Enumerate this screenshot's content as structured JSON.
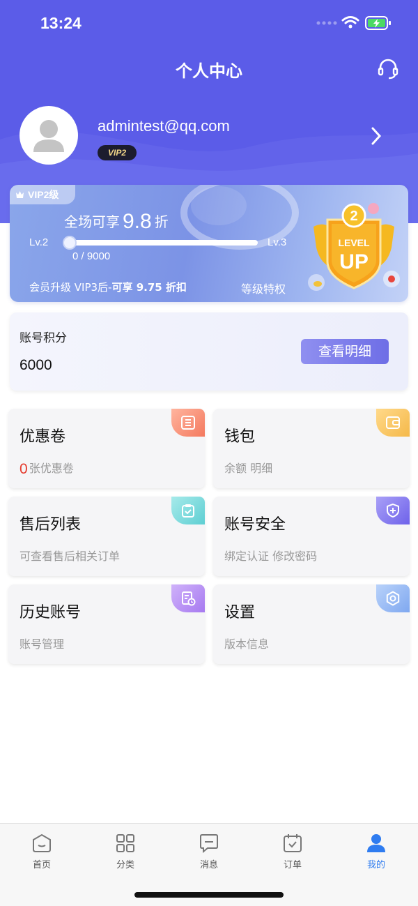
{
  "status_bar": {
    "time": "13:24"
  },
  "navbar": {
    "title": "个人中心"
  },
  "profile": {
    "email": "admintest@qq.com",
    "vip_badge": "VIP2"
  },
  "vip_card": {
    "tag": "VIP2级",
    "discount_prefix": "全场可享",
    "discount_value": "9.8",
    "discount_suffix": "折",
    "level_current": "Lv.2",
    "level_next": "Lv.3",
    "points_progress": "0 / 9000",
    "progress_fraction": 0,
    "upgrade_prefix": "会员升级 VIP3后-",
    "upgrade_bold": "可享 9.75 折扣",
    "privileges_link": "等级特权",
    "badge_text": [
      "LEVEL",
      "UP"
    ]
  },
  "points_card": {
    "label": "账号积分",
    "value": "6000",
    "detail_button": "查看明细"
  },
  "tiles": [
    {
      "title": "优惠卷",
      "count": "0",
      "subtitle": "张优惠卷",
      "icon": "coupon-icon",
      "color": "#f47a5f"
    },
    {
      "title": "钱包",
      "subtitle": "余额 明细",
      "icon": "wallet-icon",
      "color": "#f5b94a"
    },
    {
      "title": "售后列表",
      "subtitle": "可查看售后相关订单",
      "icon": "clipboard-check-icon",
      "color": "#5fcfd3"
    },
    {
      "title": "账号安全",
      "subtitle": "绑定认证 修改密码",
      "icon": "shield-plus-icon",
      "color": "#7a6ff0"
    },
    {
      "title": "历史账号",
      "subtitle": "账号管理",
      "icon": "history-doc-icon",
      "color": "#a77af0"
    },
    {
      "title": "设置",
      "subtitle": "版本信息",
      "icon": "settings-gear-icon",
      "color": "#7fa8f0"
    }
  ],
  "tabbar": {
    "items": [
      {
        "label": "首页",
        "icon": "home-icon"
      },
      {
        "label": "分类",
        "icon": "grid-icon"
      },
      {
        "label": "消息",
        "icon": "message-icon"
      },
      {
        "label": "订单",
        "icon": "calendar-check-icon"
      },
      {
        "label": "我的",
        "icon": "user-icon",
        "active": true
      }
    ],
    "active_color": "#2f7cf0"
  },
  "colors": {
    "primary": "#5b5ce8",
    "accent_red": "#e53a2d"
  }
}
